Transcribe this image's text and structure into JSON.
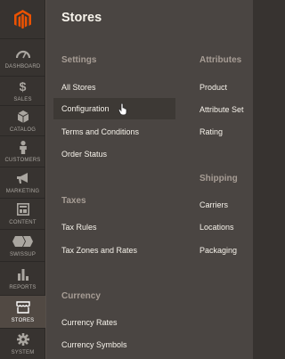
{
  "sidebar": {
    "items": [
      {
        "label": "DASHBOARD",
        "icon": "dashboard-icon"
      },
      {
        "label": "SALES",
        "icon": "dollar-icon"
      },
      {
        "label": "CATALOG",
        "icon": "cube-icon"
      },
      {
        "label": "CUSTOMERS",
        "icon": "person-icon"
      },
      {
        "label": "MARKETING",
        "icon": "megaphone-icon"
      },
      {
        "label": "CONTENT",
        "icon": "layout-icon"
      },
      {
        "label": "SWISSUP",
        "icon": "swissup-icon"
      },
      {
        "label": "REPORTS",
        "icon": "bar-chart-icon"
      },
      {
        "label": "STORES",
        "icon": "storefront-icon"
      },
      {
        "label": "SYSTEM",
        "icon": "gear-icon"
      }
    ]
  },
  "panel": {
    "title": "Stores",
    "settings": {
      "title": "Settings",
      "links": [
        "All Stores",
        "Configuration",
        "Terms and Conditions",
        "Order Status"
      ]
    },
    "taxes": {
      "title": "Taxes",
      "links": [
        "Tax Rules",
        "Tax Zones and Rates"
      ]
    },
    "currency": {
      "title": "Currency",
      "links": [
        "Currency Rates",
        "Currency Symbols"
      ]
    },
    "attributes": {
      "title": "Attributes",
      "links": [
        "Product",
        "Attribute Set",
        "Rating"
      ]
    },
    "shipping": {
      "title": "Shipping",
      "links": [
        "Carriers",
        "Locations",
        "Packaging"
      ]
    }
  },
  "colors": {
    "logo": "#eb5202",
    "sidebar_bg": "#373330",
    "active_bg": "#514943",
    "panel_bg": "#4a4542"
  }
}
